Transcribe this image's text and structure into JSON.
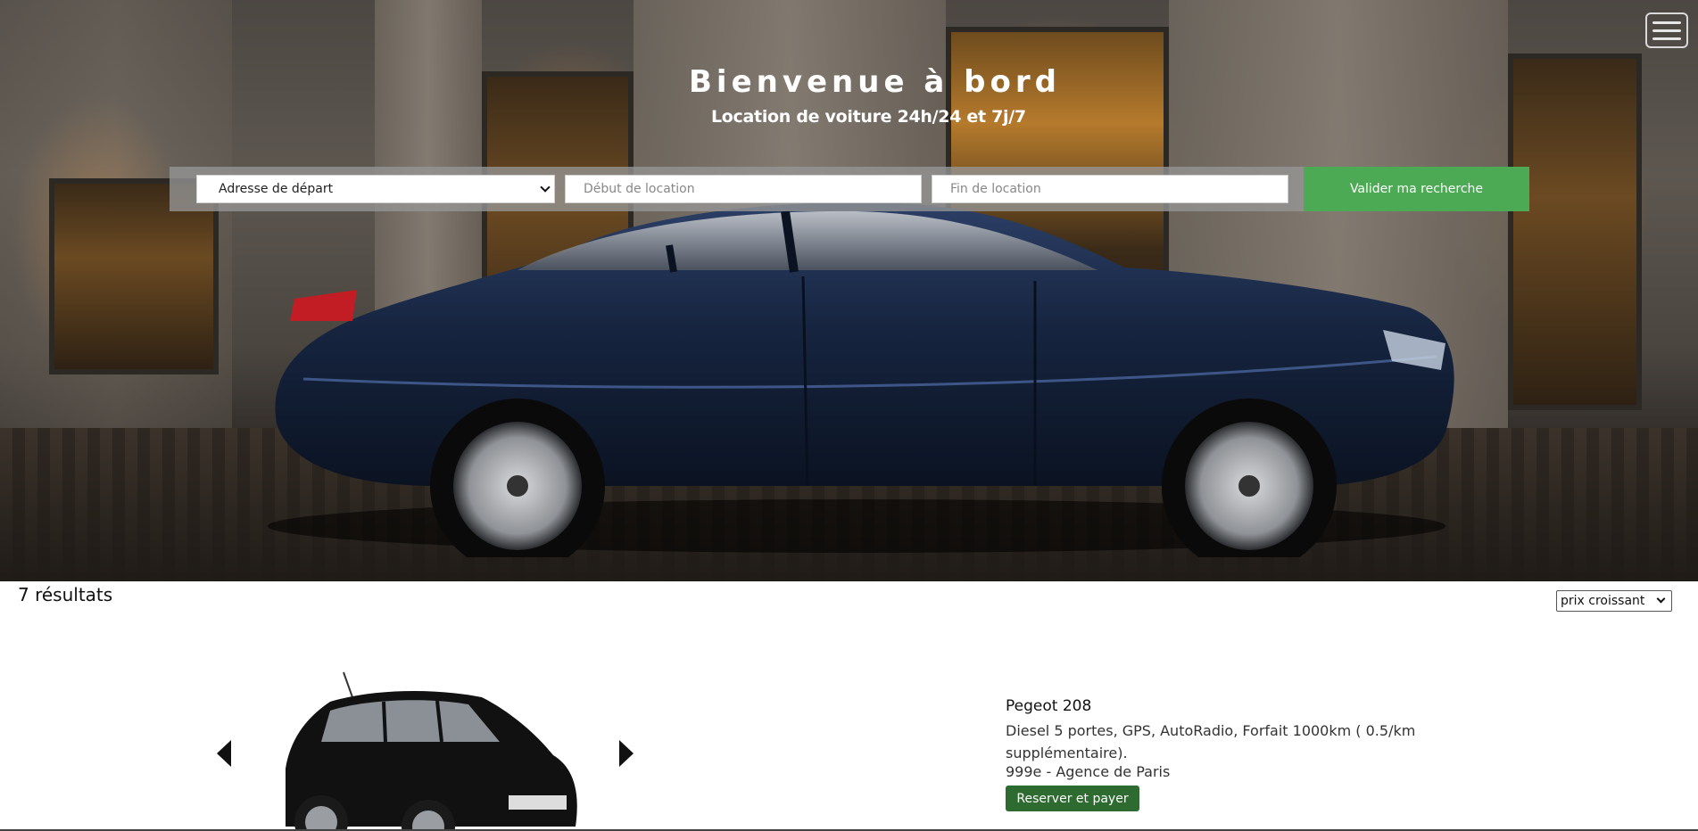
{
  "hero": {
    "title": "Bienvenue à bord",
    "subtitle": "Location de voiture 24h/24 et 7j/7"
  },
  "nav": {
    "menu_icon": "hamburger-menu-icon"
  },
  "search": {
    "departure_selected": "Adresse de départ",
    "start_placeholder": "Début de location",
    "end_placeholder": "Fin de location",
    "submit_label": "Valider ma recherche"
  },
  "results": {
    "count_label": "7 résultats",
    "sort_selected": "prix croissant",
    "items": [
      {
        "name": "Pegeot 208",
        "description": "Diesel 5 portes, GPS, AutoRadio, Forfait 1000km ( 0.5/km supplémentaire).",
        "price_agency": "999e - Agence de Paris",
        "book_label": "Reserver et payer"
      }
    ]
  },
  "colors": {
    "search_button": "#4caa55",
    "book_button": "#2e6b30"
  }
}
